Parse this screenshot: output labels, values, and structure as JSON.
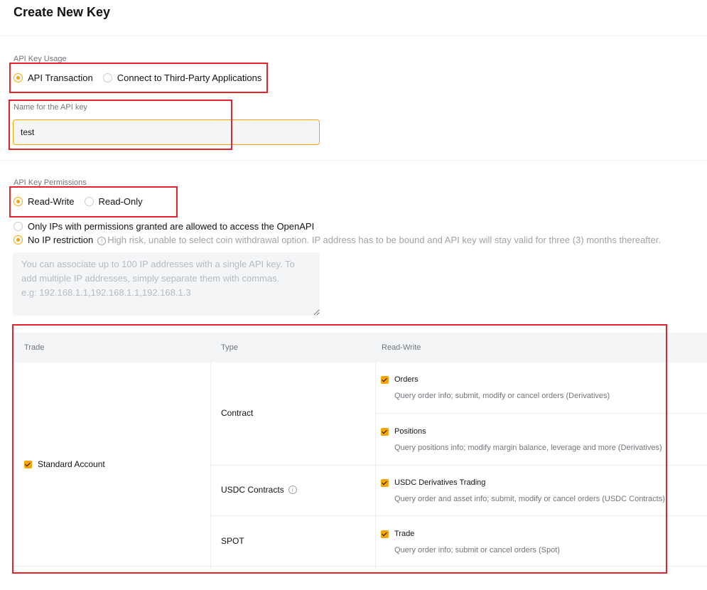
{
  "page": {
    "title": "Create New Key"
  },
  "usage": {
    "label": "API Key Usage",
    "options": [
      {
        "label": "API Transaction",
        "selected": true
      },
      {
        "label": "Connect to Third-Party Applications",
        "selected": false
      }
    ]
  },
  "name_field": {
    "label": "Name for the API key",
    "value": "test"
  },
  "permissions": {
    "label": "API Key Permissions",
    "options": [
      {
        "label": "Read-Write",
        "selected": true
      },
      {
        "label": "Read-Only",
        "selected": false
      }
    ]
  },
  "ip": {
    "options": [
      {
        "label": "Only IPs with permissions granted are allowed to access the OpenAPI",
        "selected": false
      },
      {
        "label": "No IP restriction",
        "selected": true,
        "hint": "High risk, unable to select coin withdrawal option. IP address has to be bound and API key will stay valid for three (3) months thereafter."
      }
    ],
    "placeholder": "You can associate up to 100 IP addresses with a single API key. To add multiple IP addresses, simply separate them with commas.\ne.g: 192.168.1.1,192.168.1.1,192.168.1.3"
  },
  "table": {
    "headers": {
      "trade": "Trade",
      "type": "Type",
      "access": "Read-Write"
    },
    "account": {
      "label": "Standard Account",
      "checked": true
    },
    "types": {
      "contract": "Contract",
      "usdc": "USDC Contracts",
      "spot": "SPOT"
    },
    "perms": {
      "orders": {
        "name": "Orders",
        "desc": "Query order info; submit, modify or cancel orders (Derivatives)",
        "checked": true
      },
      "positions": {
        "name": "Positions",
        "desc": "Query positions info; modify margin balance, leverage and more (Derivatives)",
        "checked": true
      },
      "usdc_trading": {
        "name": "USDC Derivatives Trading",
        "desc": "Query order and asset info; submit, modify or cancel orders (USDC Contracts)",
        "checked": true
      },
      "trade": {
        "name": "Trade",
        "desc": "Query order info; submit or cancel orders (Spot)",
        "checked": true
      }
    }
  },
  "colors": {
    "accent": "#f7a600",
    "highlight": "#e8202a"
  }
}
